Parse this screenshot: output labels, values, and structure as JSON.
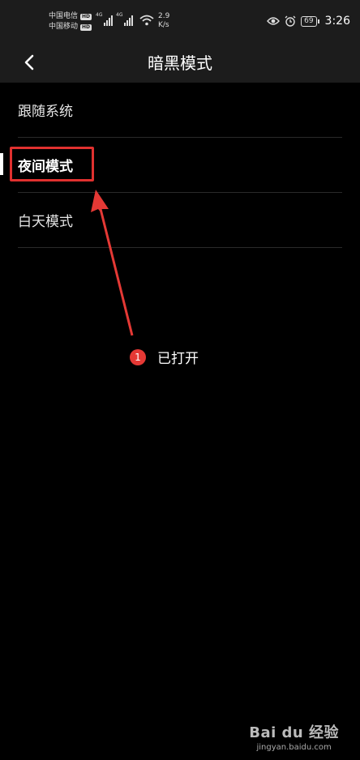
{
  "status_bar": {
    "carrier_1": "中国电信",
    "carrier_2": "中国移动",
    "hd": "HD",
    "network": "4G",
    "speed_value": "2.9",
    "speed_unit": "K/s",
    "battery": "69",
    "time": "3:26"
  },
  "header": {
    "title": "暗黑模式"
  },
  "options": [
    {
      "label": "跟随系统",
      "selected": false
    },
    {
      "label": "夜间模式",
      "selected": true
    },
    {
      "label": "白天模式",
      "selected": false
    }
  ],
  "annotation": {
    "number": "1",
    "text": "已打开",
    "color": "#e53935"
  },
  "watermark": {
    "logo": "Bai du 经验",
    "url": "jingyan.baidu.com"
  }
}
